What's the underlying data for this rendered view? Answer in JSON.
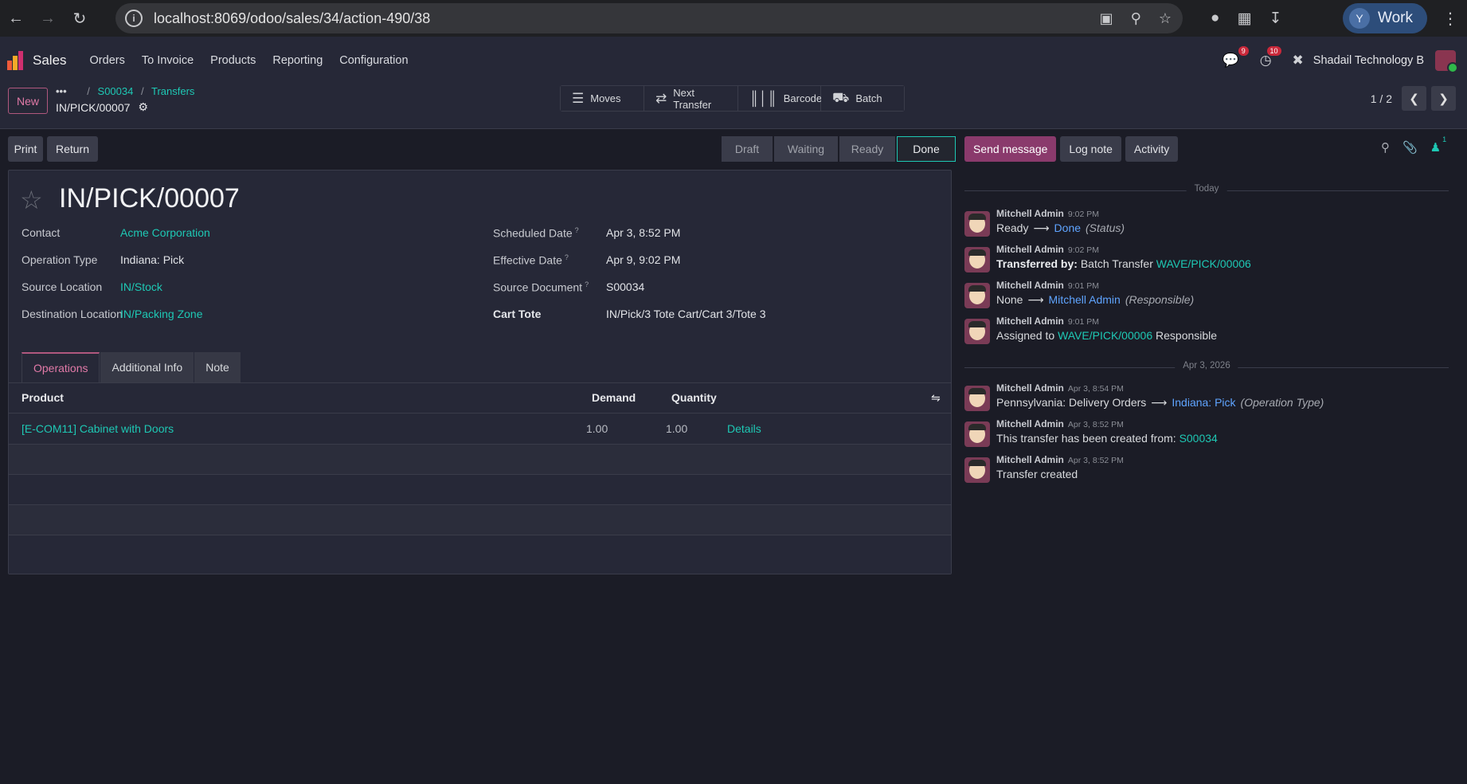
{
  "browser": {
    "url": "localhost:8069/odoo/sales/34/action-490/38",
    "profile_initial": "Y",
    "profile_label": "Work"
  },
  "topnav": {
    "app_name": "Sales",
    "menu": [
      "Orders",
      "To Invoice",
      "Products",
      "Reporting",
      "Configuration"
    ],
    "messages_badge": "9",
    "activities_badge": "10",
    "company": "Shadail Technology B"
  },
  "control": {
    "new_label": "New",
    "breadcrumb_dots": "•••",
    "breadcrumb": [
      "S00034",
      "Transfers"
    ],
    "current": "IN/PICK/00007",
    "smart_buttons": [
      {
        "icon": "☰",
        "label": "Moves"
      },
      {
        "icon": "⇄",
        "label": "Next Transfer"
      },
      {
        "icon": "║│║",
        "label": "Barcode"
      },
      {
        "icon": "⛟",
        "label": "Batch"
      }
    ],
    "pager": "1 / 2"
  },
  "actions": {
    "print": "Print",
    "return": "Return",
    "stages": [
      "Draft",
      "Waiting",
      "Ready",
      "Done"
    ],
    "active_stage": "Done"
  },
  "form": {
    "title": "IN/PICK/00007",
    "left": [
      {
        "label": "Contact",
        "value": "Acme Corporation",
        "link": true
      },
      {
        "label": "Operation Type",
        "value": "Indiana: Pick",
        "link": false
      },
      {
        "label": "Source Location",
        "value": "IN/Stock",
        "link": true
      },
      {
        "label": "Destination Location",
        "value": "IN/Packing Zone",
        "link": true
      }
    ],
    "right": [
      {
        "label": "Scheduled Date",
        "help": "?",
        "value": "Apr 3, 8:52 PM"
      },
      {
        "label": "Effective Date",
        "help": "?",
        "value": "Apr 9, 9:02 PM"
      },
      {
        "label": "Source Document",
        "help": "?",
        "value": "S00034"
      },
      {
        "label": "Cart Tote",
        "help": "",
        "value": "IN/Pick/3 Tote Cart/Cart 3/Tote 3"
      }
    ],
    "tabs": [
      "Operations",
      "Additional Info",
      "Note"
    ],
    "table": {
      "headers": {
        "product": "Product",
        "demand": "Demand",
        "quantity": "Quantity"
      },
      "rows": [
        {
          "product": "[E-COM11] Cabinet with Doors",
          "demand": "1.00",
          "quantity": "1.00",
          "details": "Details"
        }
      ]
    }
  },
  "chatter": {
    "send_message": "Send message",
    "log_note": "Log note",
    "activity": "Activity",
    "followers_count": "1",
    "date_today": "Today",
    "date_earlier": "Apr 3, 2026",
    "messages": [
      {
        "author": "Mitchell Admin",
        "time": "9:02 PM",
        "from": "Ready",
        "to": "Done",
        "field": "(Status)"
      },
      {
        "author": "Mitchell Admin",
        "time": "9:02 PM",
        "bold": "Transferred by:",
        "text": "Batch Transfer",
        "link": "WAVE/PICK/00006"
      },
      {
        "author": "Mitchell Admin",
        "time": "9:01 PM",
        "from": "None",
        "to": "Mitchell Admin",
        "field": "(Responsible)"
      },
      {
        "author": "Mitchell Admin",
        "time": "9:01 PM",
        "text": "Assigned to",
        "link": "WAVE/PICK/00006",
        "after": "Responsible"
      },
      {
        "author": "Mitchell Admin",
        "time": "Apr 3, 8:54 PM",
        "from": "Pennsylvania: Delivery Orders",
        "to": "Indiana: Pick",
        "field": "(Operation Type)"
      },
      {
        "author": "Mitchell Admin",
        "time": "Apr 3, 8:52 PM",
        "text": "This transfer has been created from:",
        "link": "S00034"
      },
      {
        "author": "Mitchell Admin",
        "time": "Apr 3, 8:52 PM",
        "text": "Transfer created"
      }
    ]
  }
}
